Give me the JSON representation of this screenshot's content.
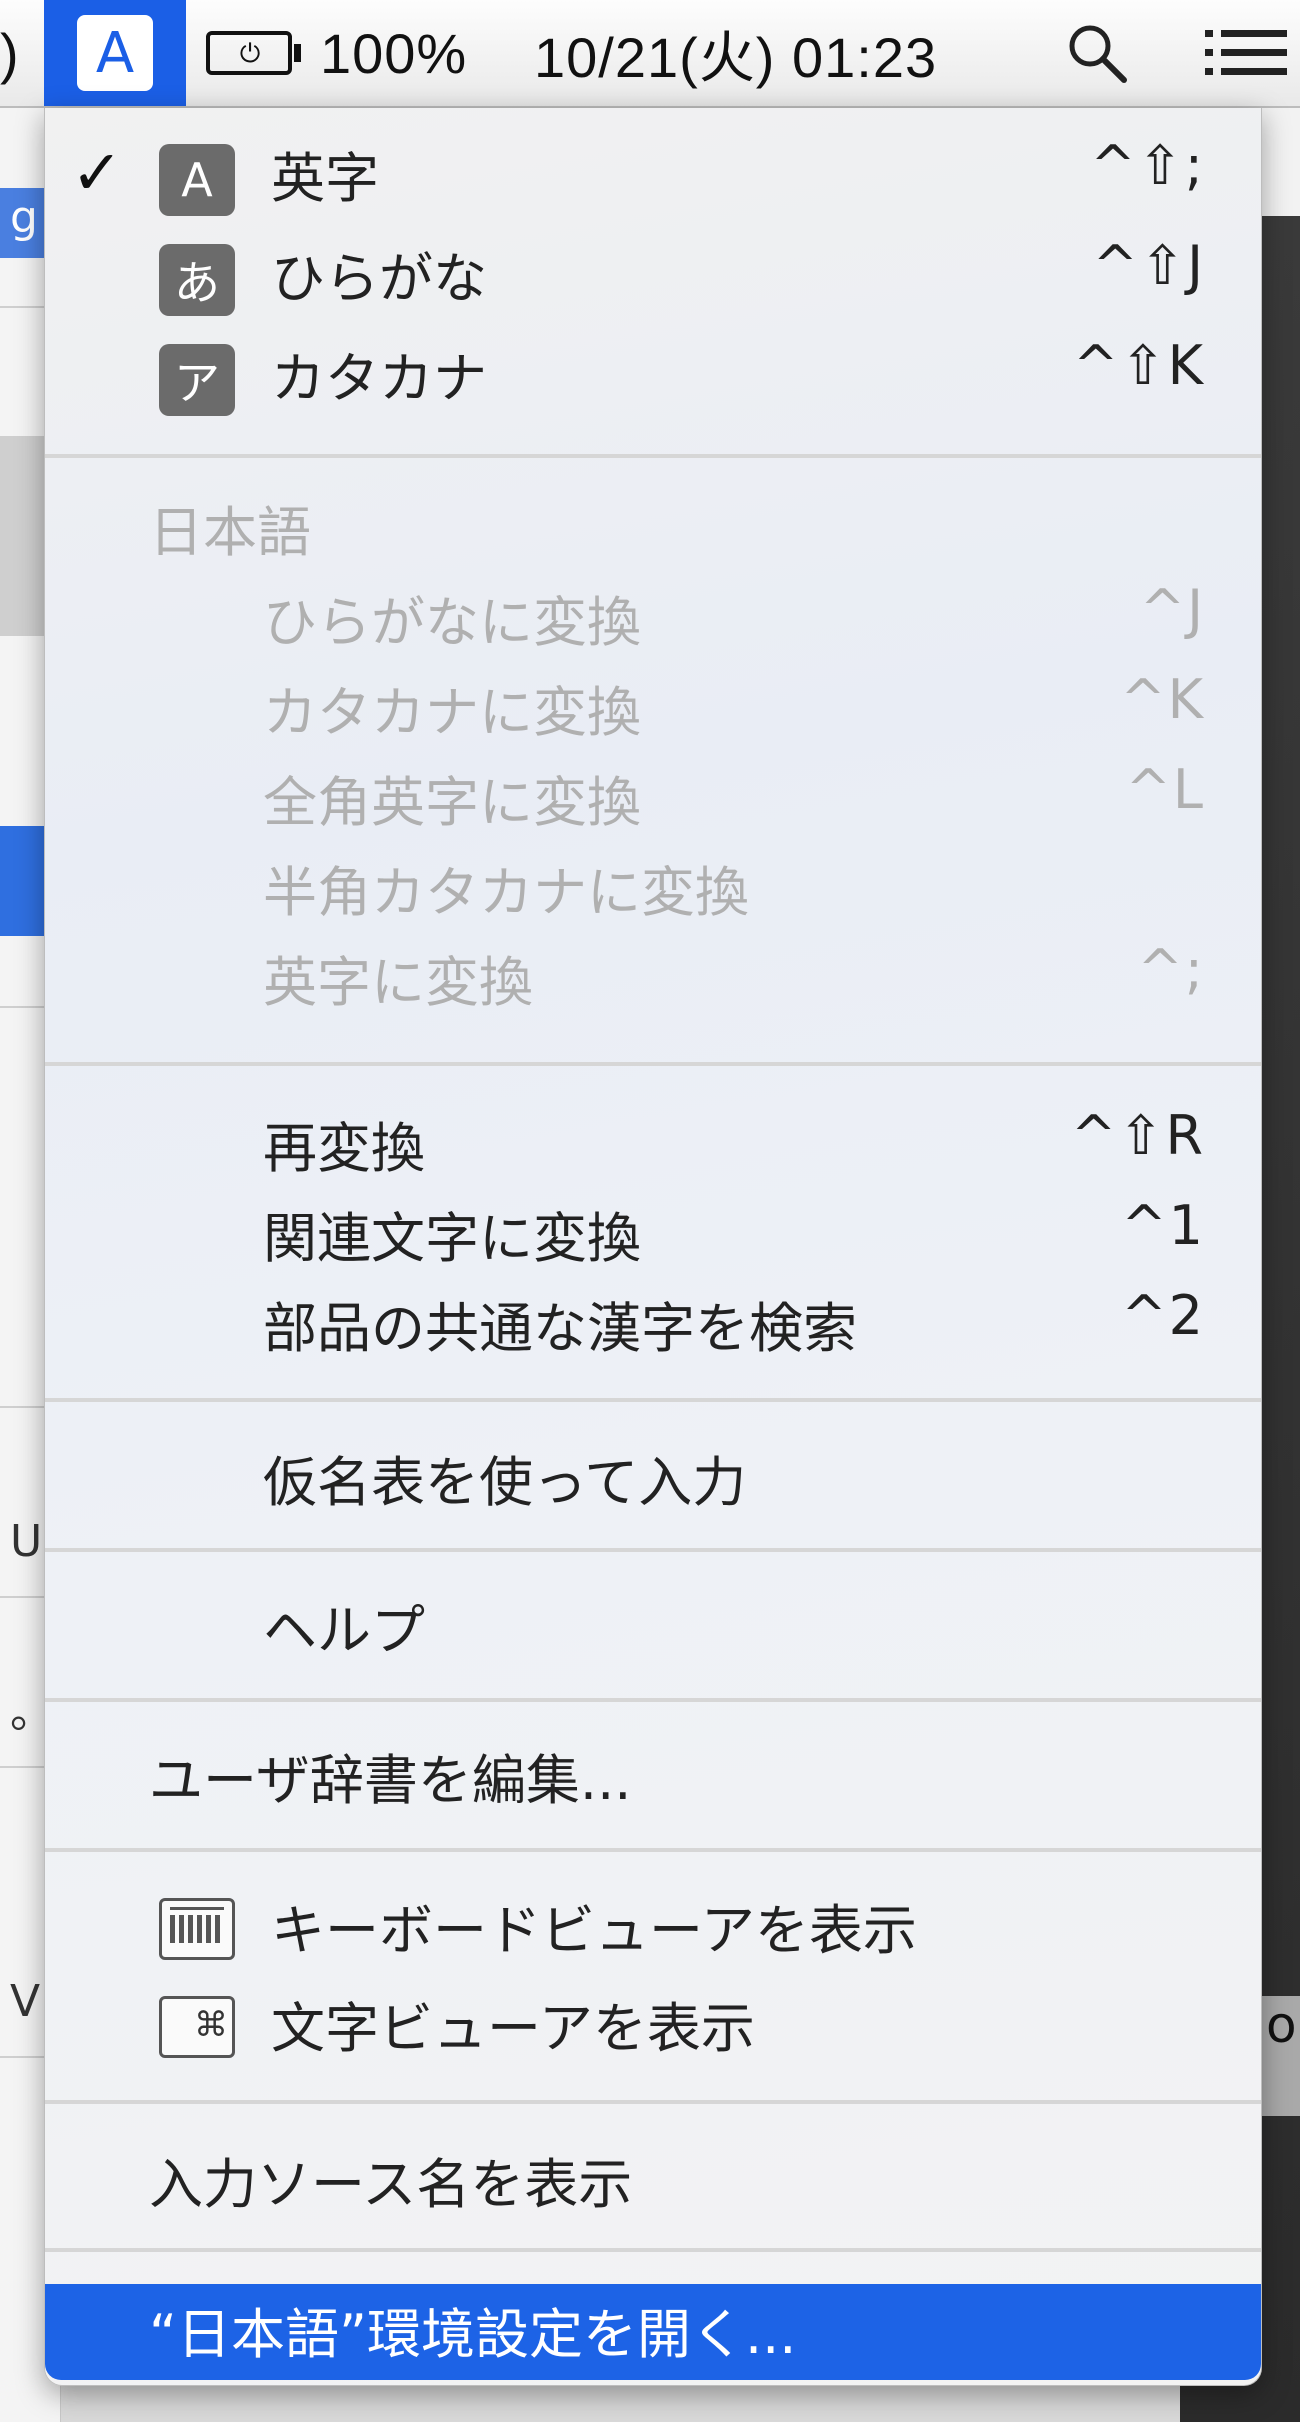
{
  "menubar": {
    "partial_item": ")",
    "ime_glyph": "A",
    "battery_text": "100%",
    "clock": "10/21(火) 01:23"
  },
  "menu": {
    "input_sources": [
      {
        "icon": "A",
        "label": "英字",
        "shortcut": "^⇧;",
        "checked": true
      },
      {
        "icon": "あ",
        "label": "ひらがな",
        "shortcut": "^⇧J",
        "checked": false
      },
      {
        "icon": "ア",
        "label": "カタカナ",
        "shortcut": "^⇧K",
        "checked": false
      }
    ],
    "japanese_section": {
      "heading": "日本語",
      "items": [
        {
          "label": "ひらがなに変換",
          "shortcut": "^J"
        },
        {
          "label": "カタカナに変換",
          "shortcut": "^K"
        },
        {
          "label": "全角英字に変換",
          "shortcut": "^L"
        },
        {
          "label": "半角カタカナに変換",
          "shortcut": ""
        },
        {
          "label": "英字に変換",
          "shortcut": "^;"
        }
      ]
    },
    "conversion_items": [
      {
        "label": "再変換",
        "shortcut": "^⇧R"
      },
      {
        "label": "関連文字に変換",
        "shortcut": "^1"
      },
      {
        "label": "部品の共通な漢字を検索",
        "shortcut": "^2"
      }
    ],
    "kana_table": "仮名表を使って入力",
    "help": "ヘルプ",
    "edit_dictionary": "ユーザ辞書を編集...",
    "keyboard_viewer": "キーボードビューアを表示",
    "character_viewer": "文字ビューアを表示",
    "show_input_source_name": "入力ソース名を表示",
    "open_preferences": "“日本語”環境設定を開く..."
  },
  "background": {
    "right_label": "o",
    "left_glyphs": [
      "g",
      "U",
      "。",
      "V"
    ]
  }
}
